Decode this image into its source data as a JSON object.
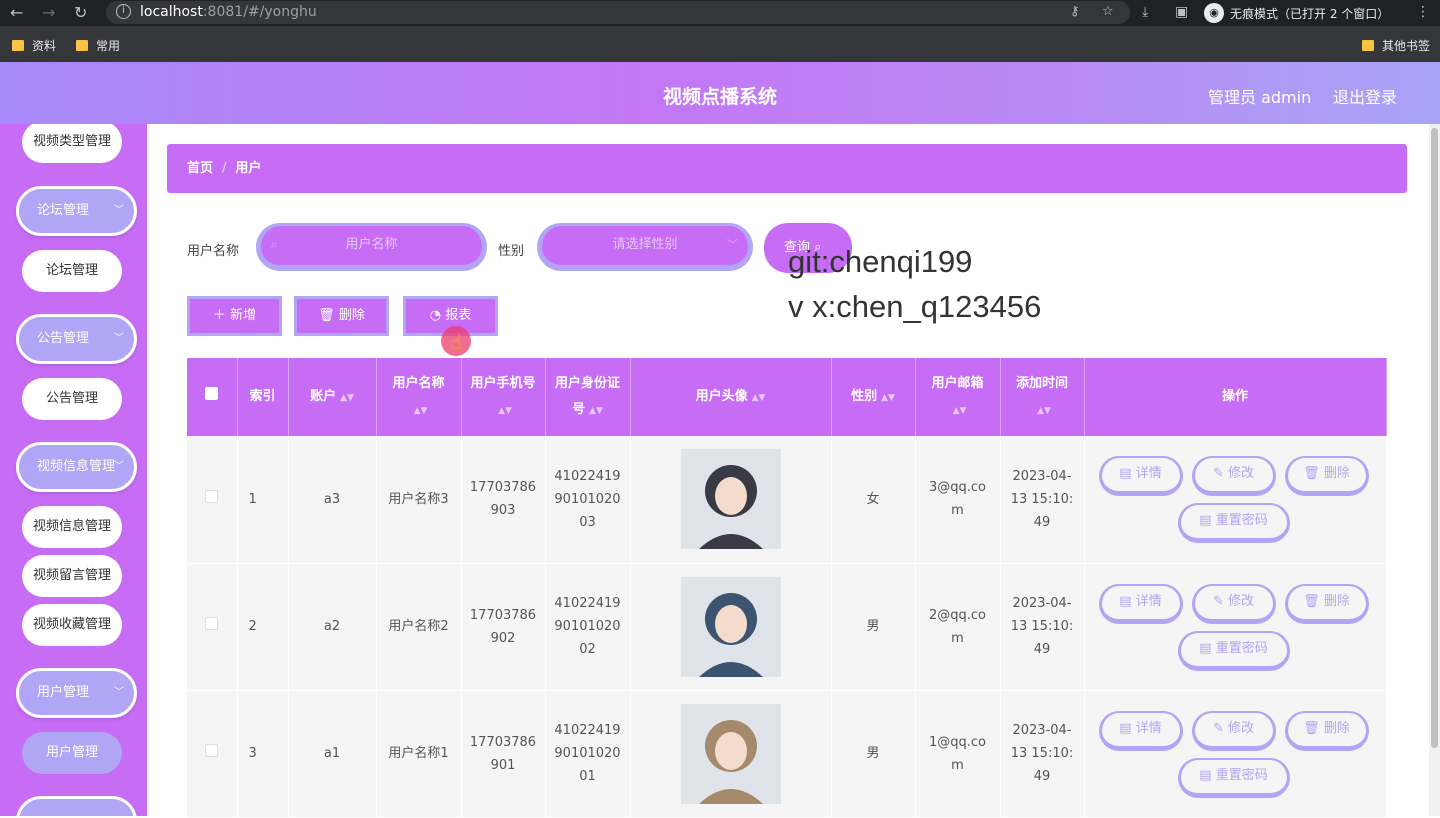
{
  "browser": {
    "url_host": "localhost",
    "url_rest": ":8081/#/yonghu",
    "incognito_label": "无痕模式（已打开 2 个窗口）",
    "bookmarks": [
      "资料",
      "常用"
    ],
    "other_bookmarks": "其他书签"
  },
  "header": {
    "title": "视频点播系统",
    "admin": "管理员 admin",
    "logout": "退出登录"
  },
  "sidebar": {
    "items": [
      {
        "label": "视频类型管理",
        "type": "item"
      },
      {
        "label": "论坛管理",
        "type": "group"
      },
      {
        "label": "论坛管理",
        "type": "item"
      },
      {
        "label": "公告管理",
        "type": "group"
      },
      {
        "label": "公告管理",
        "type": "item"
      },
      {
        "label": "视频信息管理",
        "type": "group"
      },
      {
        "label": "视频信息管理",
        "type": "item"
      },
      {
        "label": "视频留言管理",
        "type": "item"
      },
      {
        "label": "视频收藏管理",
        "type": "item"
      },
      {
        "label": "用户管理",
        "type": "group"
      },
      {
        "label": "用户管理",
        "type": "item-active"
      }
    ]
  },
  "breadcrumb": {
    "home": "首页",
    "current": "用户"
  },
  "search": {
    "name_label": "用户名称",
    "name_placeholder": "用户名称",
    "gender_label": "性别",
    "gender_placeholder": "请选择性别",
    "query": "查询"
  },
  "actions": {
    "add": "新增",
    "delete": "删除",
    "report": "报表"
  },
  "watermark": [
    "git:chenqi199",
    "v x:chen_q123456"
  ],
  "table": {
    "headers": [
      "索引",
      "账户",
      "用户名称",
      "用户手机号",
      "用户身份证号",
      "用户头像",
      "性别",
      "用户邮箱",
      "添加时间",
      "操作"
    ],
    "rows": [
      {
        "index": "1",
        "account": "a3",
        "name": "用户名称3",
        "phone": "17703786903",
        "idcard": "410224199010102003",
        "gender": "女",
        "email": "3@qq.com",
        "time": "2023-04-13 15:10:49",
        "avatar_color": "#3a3a46"
      },
      {
        "index": "2",
        "account": "a2",
        "name": "用户名称2",
        "phone": "17703786902",
        "idcard": "410224199010102002",
        "gender": "男",
        "email": "2@qq.com",
        "time": "2023-04-13 15:10:49",
        "avatar_color": "#3c5470"
      },
      {
        "index": "3",
        "account": "a1",
        "name": "用户名称1",
        "phone": "17703786901",
        "idcard": "410224199010102001",
        "gender": "男",
        "email": "1@qq.com",
        "time": "2023-04-13 15:10:49",
        "avatar_color": "#a48a6a"
      }
    ],
    "ops": {
      "detail": "详情",
      "edit": "修改",
      "delete": "删除",
      "reset": "重置密码"
    }
  }
}
